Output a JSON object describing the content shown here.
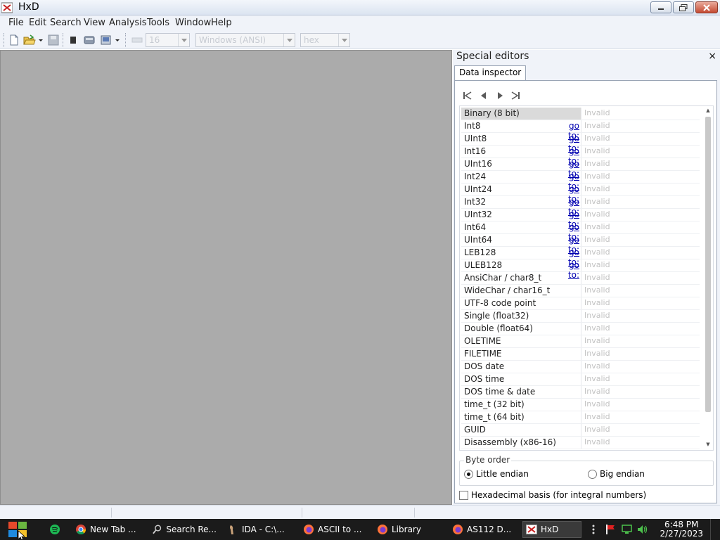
{
  "window": {
    "title": "HxD"
  },
  "menu": [
    "File",
    "Edit",
    "Search",
    "View",
    "Analysis",
    "Tools",
    "Window",
    "Help"
  ],
  "toolbar": {
    "bytes_per_row": "16",
    "charset": "Windows (ANSI)",
    "offset_base": "hex"
  },
  "panel": {
    "title": "Special editors",
    "close": "×",
    "tab": "Data inspector",
    "rows": [
      {
        "name": "Binary (8 bit)",
        "goto": "",
        "value": "Invalid"
      },
      {
        "name": "Int8",
        "goto": "go to:",
        "value": "Invalid"
      },
      {
        "name": "UInt8",
        "goto": "go to:",
        "value": "Invalid"
      },
      {
        "name": "Int16",
        "goto": "go to:",
        "value": "Invalid"
      },
      {
        "name": "UInt16",
        "goto": "go to:",
        "value": "Invalid"
      },
      {
        "name": "Int24",
        "goto": "go to:",
        "value": "Invalid"
      },
      {
        "name": "UInt24",
        "goto": "go to:",
        "value": "Invalid"
      },
      {
        "name": "Int32",
        "goto": "go to:",
        "value": "Invalid"
      },
      {
        "name": "UInt32",
        "goto": "go to:",
        "value": "Invalid"
      },
      {
        "name": "Int64",
        "goto": "go to:",
        "value": "Invalid"
      },
      {
        "name": "UInt64",
        "goto": "go to:",
        "value": "Invalid"
      },
      {
        "name": "LEB128",
        "goto": "go to:",
        "value": "Invalid"
      },
      {
        "name": "ULEB128",
        "goto": "go to:",
        "value": "Invalid"
      },
      {
        "name": "AnsiChar / char8_t",
        "goto": "",
        "value": "Invalid"
      },
      {
        "name": "WideChar / char16_t",
        "goto": "",
        "value": "Invalid"
      },
      {
        "name": "UTF-8 code point",
        "goto": "",
        "value": "Invalid"
      },
      {
        "name": "Single (float32)",
        "goto": "",
        "value": "Invalid"
      },
      {
        "name": "Double (float64)",
        "goto": "",
        "value": "Invalid"
      },
      {
        "name": "OLETIME",
        "goto": "",
        "value": "Invalid"
      },
      {
        "name": "FILETIME",
        "goto": "",
        "value": "Invalid"
      },
      {
        "name": "DOS date",
        "goto": "",
        "value": "Invalid"
      },
      {
        "name": "DOS time",
        "goto": "",
        "value": "Invalid"
      },
      {
        "name": "DOS time & date",
        "goto": "",
        "value": "Invalid"
      },
      {
        "name": "time_t (32 bit)",
        "goto": "",
        "value": "Invalid"
      },
      {
        "name": "time_t (64 bit)",
        "goto": "",
        "value": "Invalid"
      },
      {
        "name": "GUID",
        "goto": "",
        "value": "Invalid"
      },
      {
        "name": "Disassembly (x86-16)",
        "goto": "",
        "value": "Invalid"
      }
    ],
    "byte_order": {
      "legend": "Byte order",
      "little": "Little endian",
      "big": "Big endian",
      "selected": "little"
    },
    "hex_basis": {
      "label": "Hexadecimal basis (for integral numbers)",
      "checked": false
    }
  },
  "taskbar": {
    "apps": [
      "New Tab ...",
      "Search Re...",
      "IDA - C:\\...",
      "ASCII to ...",
      "Library",
      "AS112 D...",
      "HxD"
    ],
    "time": "6:48 PM",
    "date": "2/27/2023"
  },
  "colors": {
    "link": "#0000b0",
    "invalid": "#c2c2c2",
    "workspace": "#ababab"
  }
}
